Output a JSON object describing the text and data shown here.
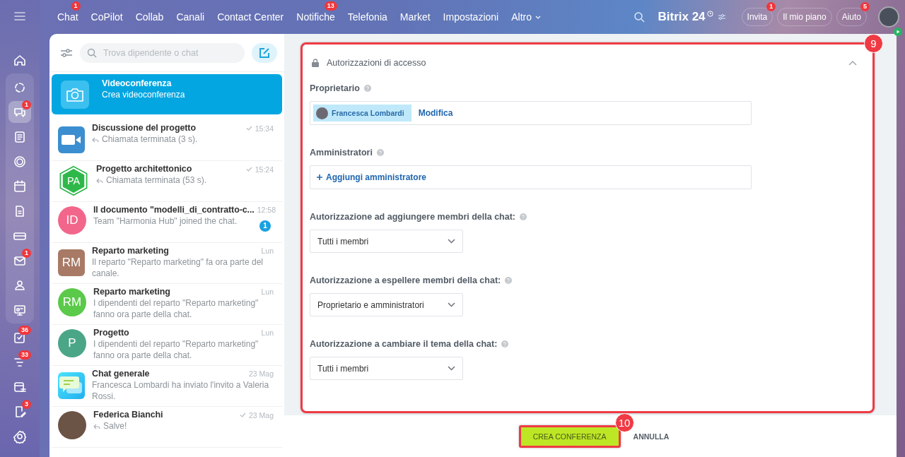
{
  "top_nav": {
    "items": [
      {
        "label": "Chat",
        "badge": "1"
      },
      {
        "label": "CoPilot"
      },
      {
        "label": "Collab"
      },
      {
        "label": "Canali"
      },
      {
        "label": "Contact Center"
      },
      {
        "label": "Notifiche",
        "badge": "13"
      },
      {
        "label": "Telefonia"
      },
      {
        "label": "Market"
      },
      {
        "label": "Impostazioni"
      },
      {
        "label": "Altro",
        "kind": "dropdown"
      }
    ],
    "brand": "Bitrix 24",
    "buttons": [
      {
        "label": "Invita",
        "badge": "1"
      },
      {
        "label": "Il mio piano"
      },
      {
        "label": "Aiuto",
        "badge": "5"
      }
    ]
  },
  "sidebar": {
    "items": [
      {
        "group": false,
        "selected": false
      },
      {
        "group": true,
        "selected": false
      },
      {
        "group": true,
        "selected": true,
        "badge": "1"
      },
      {
        "group": true,
        "selected": false
      },
      {
        "group": true,
        "selected": false
      },
      {
        "group": true,
        "selected": false
      },
      {
        "group": true,
        "selected": false
      },
      {
        "group": true,
        "selected": false
      },
      {
        "group": true,
        "selected": false,
        "badge": "1"
      },
      {
        "group": true,
        "selected": false
      },
      {
        "group": true,
        "selected": false
      },
      {
        "group": false,
        "selected": false,
        "badge": "36"
      },
      {
        "group": false,
        "selected": false,
        "badge": "33"
      },
      {
        "group": false,
        "selected": false
      },
      {
        "group": false,
        "selected": false,
        "badge": "3"
      }
    ]
  },
  "chat_list": {
    "search": {
      "placeholder": "Trova dipendente o chat"
    },
    "items": [
      {
        "title": "Videoconferenza",
        "preview": "Crea videoconferenza",
        "kind": "camera",
        "selected": true,
        "reply": false,
        "read": false
      },
      {
        "title": "Discussione del progetto",
        "preview": "Chiamata terminata (3 s).",
        "time": "15:34",
        "kind": "video",
        "color": "#3b8fd0",
        "selected": false,
        "reply": true,
        "read": true
      },
      {
        "title": "Progetto architettonico",
        "preview": "Chiamata terminata (53 s).",
        "time": "15:24",
        "kind": "hexagon",
        "initials": "PA",
        "color": "#2fb84a",
        "selected": false,
        "reply": true,
        "read": true
      },
      {
        "title": "Il documento \"modelli_di_contratto-c...",
        "preview": "Team \"Harmonia Hub\" joined the chat.",
        "time": "12:58",
        "kind": "circle",
        "initials": "ID",
        "color": "#f2668b",
        "unread": "1",
        "selected": false,
        "reply": false,
        "read": false
      },
      {
        "title": "Reparto marketing",
        "preview": "Il reparto \"Reparto marketing\" fa ora parte del canale.",
        "time": "Lun",
        "kind": "rounded",
        "initials": "RM",
        "color": "#a87a66",
        "selected": false,
        "reply": false,
        "read": false
      },
      {
        "title": "Reparto marketing",
        "preview": "I dipendenti del reparto \"Reparto marketing\" fanno ora parte della chat.",
        "time": "Lun",
        "kind": "circle",
        "initials": "RM",
        "color": "#5bc94a",
        "selected": false,
        "reply": false,
        "read": false
      },
      {
        "title": "Progetto",
        "preview": "I dipendenti del reparto \"Reparto marketing\" fanno ora parte della chat.",
        "time": "Lun",
        "kind": "circle",
        "initials": "P",
        "color": "#4aa687",
        "selected": false,
        "reply": false,
        "read": false
      },
      {
        "title": "Chat generale",
        "preview": "Francesca Lombardi ha inviato l'invito a Valeria Rossi.",
        "time": "23 Mag",
        "kind": "chat",
        "selected": false,
        "reply": false,
        "read": false
      },
      {
        "title": "Federica Bianchi",
        "preview": "Salve!",
        "time": "23 Mag",
        "kind": "photo",
        "selected": false,
        "reply": true,
        "read": true
      }
    ]
  },
  "settings": {
    "section": {
      "title": "Autorizzazioni di accesso",
      "expanded": true
    },
    "owner": {
      "label": "Proprietario",
      "name": "Francesca Lombardi",
      "action": "Modifica"
    },
    "admins": {
      "label": "Amministratori",
      "action": "Aggiungi amministratore"
    },
    "selects": [
      {
        "label": "Autorizzazione ad aggiungere membri della chat:",
        "value": "Tutti i membri"
      },
      {
        "label": "Autorizzazione a espellere membri della chat:",
        "value": "Proprietario e amministratori"
      },
      {
        "label": "Autorizzazione a cambiare il tema della chat:",
        "value": "Tutti i membri"
      }
    ],
    "step_marker": "9"
  },
  "footer": {
    "primary": "CREA CONFERENZA",
    "secondary": "ANNULLA",
    "step_marker": "10"
  }
}
